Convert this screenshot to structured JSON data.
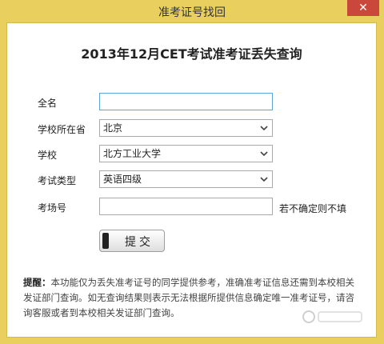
{
  "window": {
    "title": "准考证号找回",
    "close": "✕"
  },
  "form": {
    "heading": "2013年12月CET考试准考证丢失查询",
    "name_label": "全名",
    "province_label": "学校所在省",
    "province_value": "北京",
    "school_label": "学校",
    "school_value": "北方工业大学",
    "exam_type_label": "考试类型",
    "exam_type_value": "英语四级",
    "room_label": "考场号",
    "room_hint": "若不确定则不填",
    "submit_label": "提交"
  },
  "notice": {
    "prefix": "提醒：",
    "text": "本功能仅为丢失准考证号的同学提供参考，准确准考证信息还需到本校相关发证部门查询。如无查询结果则表示无法根据所提供信息确定唯一准考证号，请咨询客服或者到本校相关发证部门查询。"
  },
  "icons": {
    "dropdown": "chevron-down-icon",
    "watermark": "baidu-watermark-icon"
  },
  "colors": {
    "frame": "#e9cf5e",
    "close": "#c9483b",
    "focus": "#5fa5d9"
  }
}
